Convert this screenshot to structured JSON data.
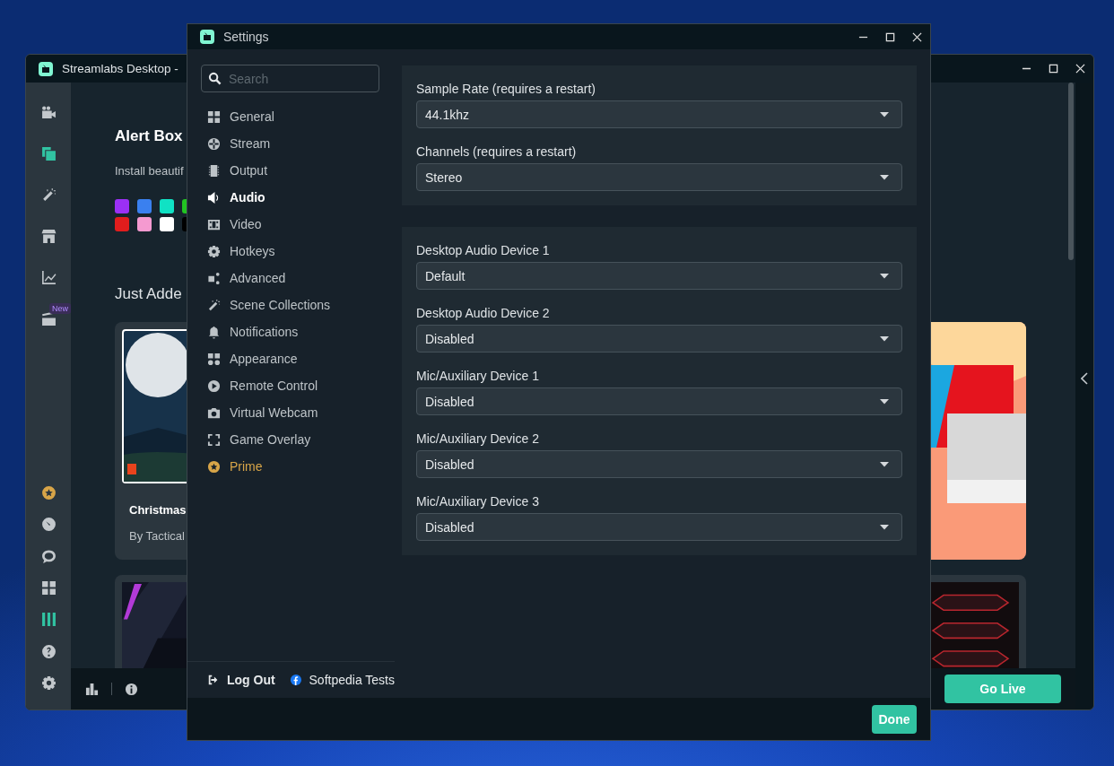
{
  "main_window": {
    "title": "Streamlabs Desktop -",
    "nav_badge": "New",
    "heading": "Alert Box",
    "description": "Install beautif",
    "swatches": [
      {
        "color": "#9b30f5"
      },
      {
        "color": "#3a80ef"
      },
      {
        "color": "#10e2c4"
      },
      {
        "color": "#22c322"
      },
      {
        "color": "#e11d1d"
      },
      {
        "color": "#f59ad0"
      },
      {
        "color": "#ffffff"
      },
      {
        "color": "#000000"
      }
    ],
    "section_title": "Just Adde",
    "card": {
      "title": "Christmas",
      "author": "By Tactical"
    },
    "go_live": "Go Live"
  },
  "settings": {
    "title": "Settings",
    "search": {
      "placeholder": "Search"
    },
    "nav": [
      {
        "label": "General",
        "selected": false,
        "kind": "page"
      },
      {
        "label": "Stream",
        "selected": false,
        "kind": "page"
      },
      {
        "label": "Output",
        "selected": false,
        "kind": "page"
      },
      {
        "label": "Audio",
        "selected": true,
        "kind": "page"
      },
      {
        "label": "Video",
        "selected": false,
        "kind": "page"
      },
      {
        "label": "Hotkeys",
        "selected": false,
        "kind": "page"
      },
      {
        "label": "Advanced",
        "selected": false,
        "kind": "page"
      },
      {
        "label": "Scene Collections",
        "selected": false,
        "kind": "page"
      },
      {
        "label": "Notifications",
        "selected": false,
        "kind": "page"
      },
      {
        "label": "Appearance",
        "selected": false,
        "kind": "page"
      },
      {
        "label": "Remote Control",
        "selected": false,
        "kind": "page"
      },
      {
        "label": "Virtual Webcam",
        "selected": false,
        "kind": "page"
      },
      {
        "label": "Game Overlay",
        "selected": false,
        "kind": "page"
      },
      {
        "label": "Prime",
        "selected": false,
        "kind": "premium"
      }
    ],
    "groups": [
      {
        "fields": [
          {
            "label": "Sample Rate (requires a restart)",
            "value": "44.1khz"
          },
          {
            "label": "Channels (requires a restart)",
            "value": "Stereo"
          }
        ]
      },
      {
        "fields": [
          {
            "label": "Desktop Audio Device 1",
            "value": "Default"
          },
          {
            "label": "Desktop Audio Device 2",
            "value": "Disabled"
          },
          {
            "label": "Mic/Auxiliary Device 1",
            "value": "Disabled"
          },
          {
            "label": "Mic/Auxiliary Device 2",
            "value": "Disabled"
          },
          {
            "label": "Mic/Auxiliary Device 3",
            "value": "Disabled"
          }
        ]
      }
    ],
    "logout": "Log Out",
    "account": "Softpedia Tests",
    "done": "Done"
  }
}
